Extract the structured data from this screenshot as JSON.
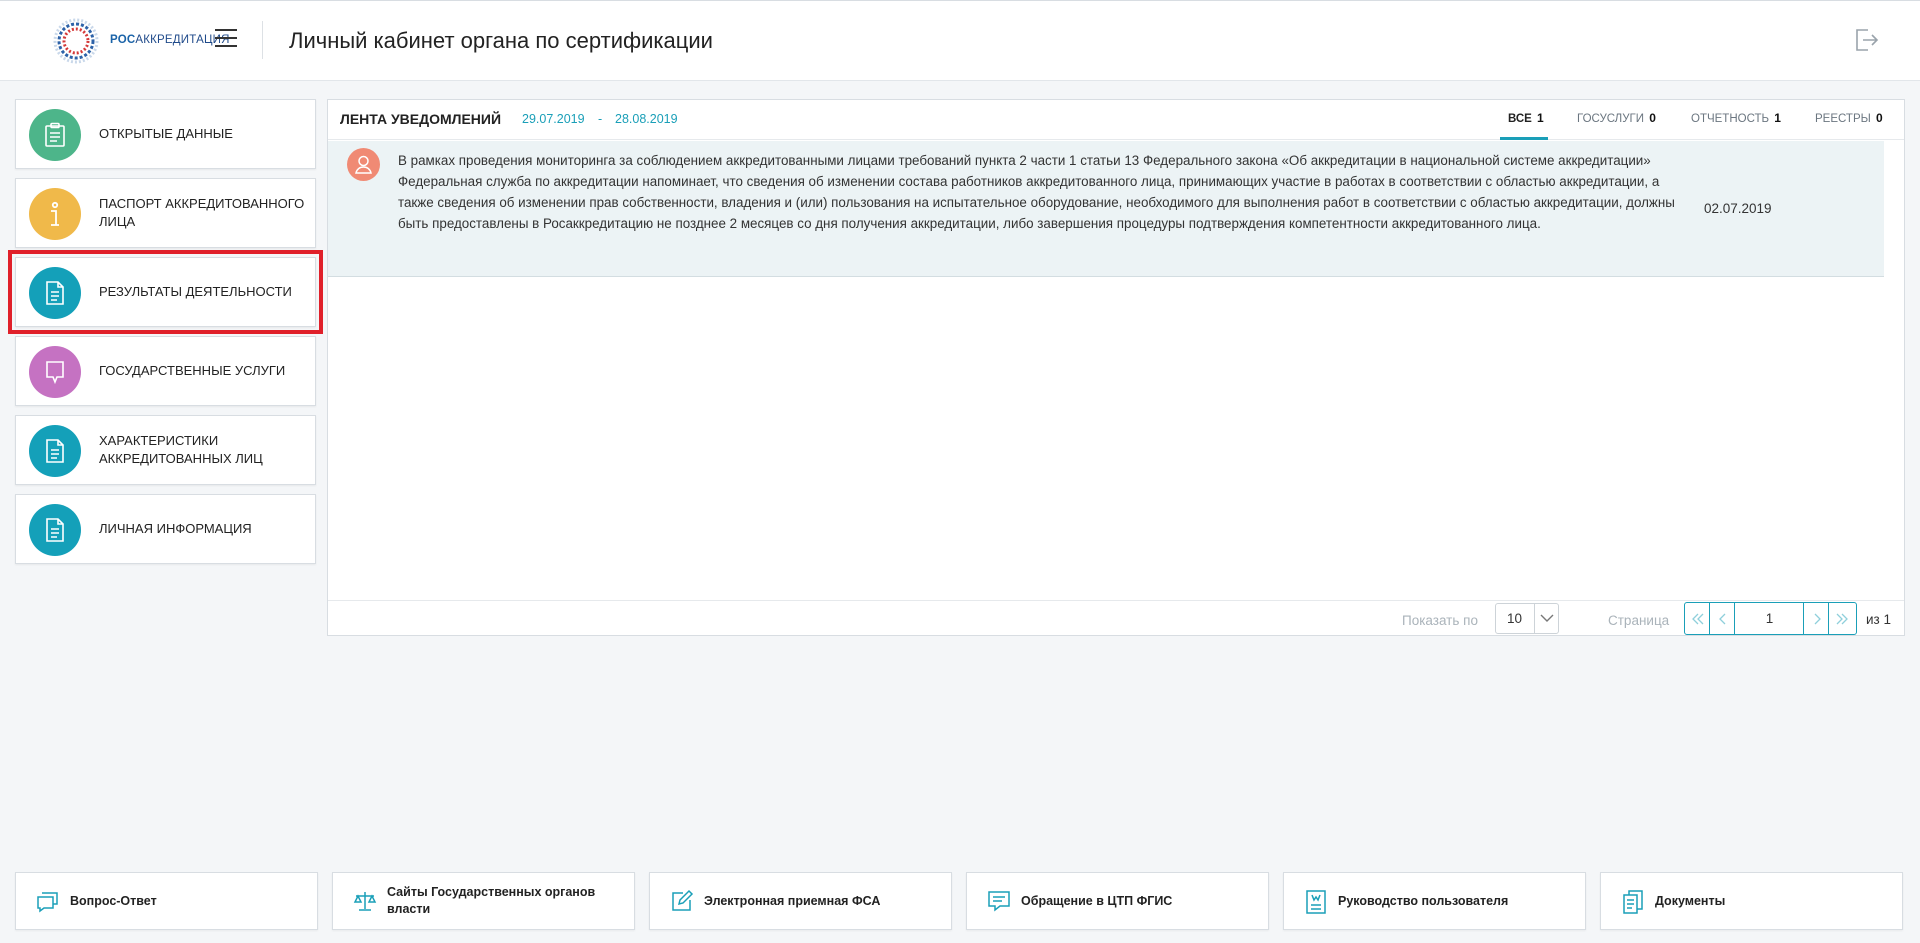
{
  "header": {
    "logo_text_prefix": "РОС",
    "logo_text_suffix": "АККРЕДИТАЦИЯ",
    "title": "Личный кабинет органа по сертификации"
  },
  "sidebar": {
    "items": [
      {
        "label": "ОТКРЫТЫЕ ДАННЫЕ",
        "icon": "clipboard-icon",
        "color": "#4db58a"
      },
      {
        "label": "ПАСПОРТ АККРЕДИТОВАННОГО ЛИЦА",
        "icon": "info-icon",
        "color": "#f0b94a"
      },
      {
        "label": "РЕЗУЛЬТАТЫ ДЕЯТЕЛЬНОСТИ",
        "icon": "document-icon",
        "color": "#14a0b9",
        "active": true
      },
      {
        "label": "ГОСУДАРСТВЕННЫЕ УСЛУГИ",
        "icon": "chat-bubble-icon",
        "color": "#c572c2"
      },
      {
        "label": "ХАРАКТЕРИСТИКИ АККРЕДИТОВАННЫХ ЛИЦ",
        "icon": "document-icon",
        "color": "#14a0b9"
      },
      {
        "label": "ЛИЧНАЯ ИНФОРМАЦИЯ",
        "icon": "document-icon",
        "color": "#14a0b9"
      }
    ]
  },
  "feed": {
    "title": "ЛЕНТА УВЕДОМЛЕНИЙ",
    "date_from": "29.07.2019",
    "date_sep": "-",
    "date_to": "28.08.2019",
    "tabs": [
      {
        "label": "ВСЕ",
        "count": "1",
        "active": true
      },
      {
        "label": "ГОСУСЛУГИ",
        "count": "0"
      },
      {
        "label": "ОТЧЕТНОСТЬ",
        "count": "1"
      },
      {
        "label": "РЕЕСТРЫ",
        "count": "0"
      }
    ],
    "notifications": [
      {
        "text": "В рамках проведения мониторинга за соблюдением аккредитованными лицами требований пункта 2 части 1 статьи 13 Федерального закона «Об аккредитации в национальной системе аккредитации» Федеральная служба по аккредитации напоминает, что сведения об изменении состава работников аккредитованного лица, принимающих участие в работах в соответствии с областью аккредитации, а также сведения об изменении прав собственности, владения и (или) пользования на испытательное оборудование, необходимого для выполнения работ в соответствии с областью аккредитации, должны быть предоставлены в Росаккредитацию не позднее 2 месяцев со дня получения аккредитации, либо завершения процедуры подтверждения компетентности аккредитованного лица.",
        "date": "02.07.2019"
      }
    ],
    "footer": {
      "show_label": "Показать по",
      "page_size": "10",
      "page_label": "Страница",
      "current_page": "1",
      "of_label": "из 1"
    }
  },
  "bottom_links": [
    {
      "label": "Вопрос-Ответ",
      "icon": "chat-icon"
    },
    {
      "label": "Сайты Государственных органов власти",
      "icon": "scales-icon"
    },
    {
      "label": "Электронная приемная ФСА",
      "icon": "edit-icon"
    },
    {
      "label": "Обращение в ЦТП ФГИС",
      "icon": "message-icon"
    },
    {
      "label": "Руководство пользователя",
      "icon": "book-icon"
    },
    {
      "label": "Документы",
      "icon": "documents-icon"
    }
  ],
  "colors": {
    "accent": "#1a9fb8",
    "highlight": "#e0202a"
  }
}
